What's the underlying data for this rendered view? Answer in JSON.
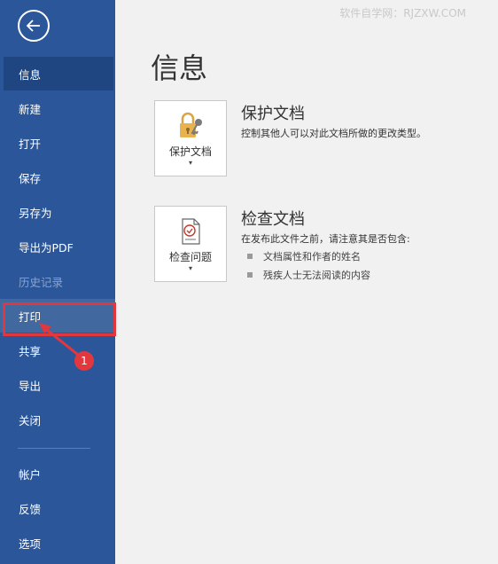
{
  "watermark": "软件自学网：RJZXW.COM",
  "sidebar": {
    "items": [
      {
        "label": "信息"
      },
      {
        "label": "新建"
      },
      {
        "label": "打开"
      },
      {
        "label": "保存"
      },
      {
        "label": "另存为"
      },
      {
        "label": "导出为PDF"
      },
      {
        "label": "历史记录"
      },
      {
        "label": "打印"
      },
      {
        "label": "共享"
      },
      {
        "label": "导出"
      },
      {
        "label": "关闭"
      },
      {
        "label": "帐户"
      },
      {
        "label": "反馈"
      },
      {
        "label": "选项"
      }
    ],
    "active_index": 0,
    "disabled_index": 6
  },
  "annotation": {
    "number": "1",
    "color": "#e3373e"
  },
  "main": {
    "title": "信息",
    "protect": {
      "tile_label": "保护文档",
      "caret": "▾",
      "title": "保护文档",
      "desc": "控制其他人可以对此文档所做的更改类型。"
    },
    "inspect": {
      "tile_label": "检查问题",
      "caret": "▾",
      "title": "检查文档",
      "desc": "在发布此文件之前，请注意其是否包含:",
      "bullets": [
        "文档属性和作者的姓名",
        "残疾人士无法阅读的内容"
      ]
    }
  },
  "colors": {
    "sidebar": "#2b579a",
    "active": "#1f4680",
    "background": "#f1f1f1"
  }
}
